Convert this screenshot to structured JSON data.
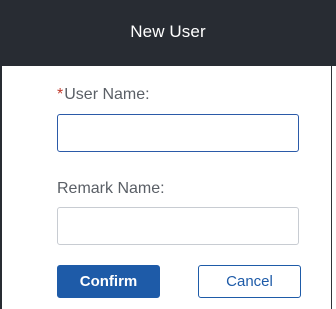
{
  "dialog": {
    "title": "New User"
  },
  "form": {
    "user_name": {
      "required_marker": "*",
      "label": "User Name:",
      "value": "",
      "placeholder": ""
    },
    "remark_name": {
      "label": "Remark Name:",
      "value": "",
      "placeholder": ""
    }
  },
  "actions": {
    "confirm_label": "Confirm",
    "cancel_label": "Cancel"
  },
  "colors": {
    "header_bg": "#282c33",
    "primary": "#1e5ba8",
    "required": "#c0392b"
  }
}
